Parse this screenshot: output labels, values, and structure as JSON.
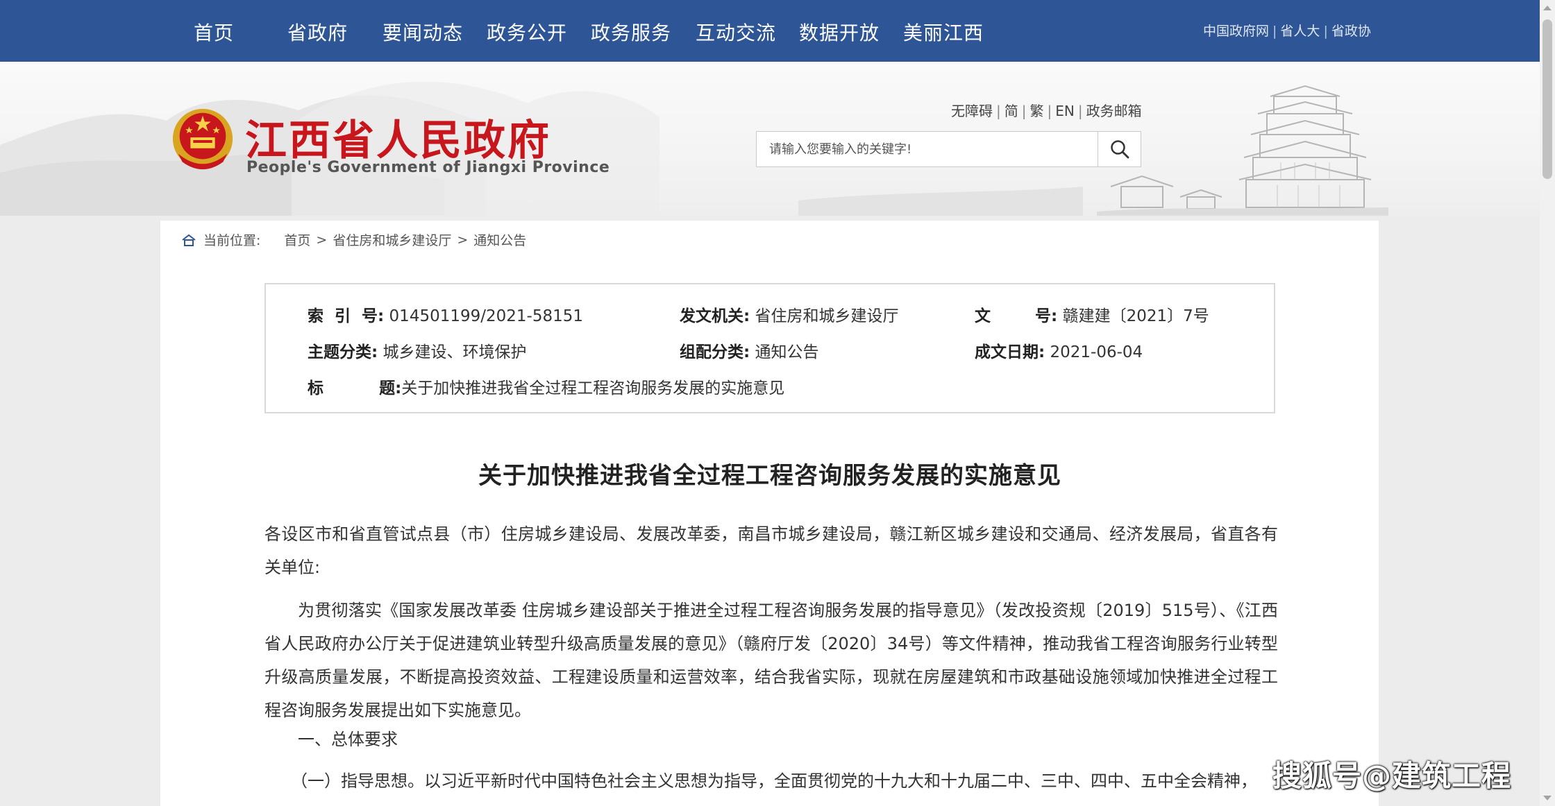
{
  "nav": {
    "items": [
      "首页",
      "省政府",
      "要闻动态",
      "政务公开",
      "政务服务",
      "互动交流",
      "数据开放",
      "美丽江西"
    ],
    "links": [
      "中国政府网",
      "省人大",
      "省政协"
    ]
  },
  "header": {
    "title": "江西省人民政府",
    "subtitle": "People's Government of Jiangxi Province",
    "utilities": [
      "无障碍",
      "简",
      "繁",
      "EN",
      "政务邮箱"
    ],
    "search_placeholder": "请输入您要输入的关键字!"
  },
  "breadcrumb": {
    "label": "当前位置:",
    "items": [
      "首页",
      "省住房和城乡建设厅",
      "通知公告"
    ]
  },
  "doc_info": {
    "index_key": "索  引  号:",
    "index_value": "014501199/2021-58151",
    "issuer_key": "发文机关:",
    "issuer_value": "省住房和城乡建设厅",
    "number_key": "文        号:",
    "number_value": "赣建建〔2021〕7号",
    "subject_key": "主题分类:",
    "subject_value": "城乡建设、环境保护",
    "category_key": "组配分类:",
    "category_value": "通知公告",
    "date_key": "成文日期:",
    "date_value": "2021-06-04",
    "title_key": "标          题:",
    "title_value": "关于加快推进我省全过程工程咨询服务发展的实施意见"
  },
  "article": {
    "title": "关于加快推进我省全过程工程咨询服务发展的实施意见",
    "addressee": "各设区市和省直管试点县（市）住房城乡建设局、发展改革委，南昌市城乡建设局，赣江新区城乡建设和交通局、经济发展局，省直各有关单位:",
    "para1": "为贯彻落实《国家发展改革委 住房城乡建设部关于推进全过程工程咨询服务发展的指导意见》（发改投资规〔2019〕515号）、《江西省人民政府办公厅关于促进建筑业转型升级高质量发展的意见》（赣府厅发〔2020〕34号）等文件精神，推动我省工程咨询服务行业转型升级高质量发展，不断提高投资效益、工程建设质量和运营效率，结合我省实际，现就在房屋建筑和市政基础设施领域加快推进全过程工程咨询服务发展提出如下实施意见。",
    "section1": "一、总体要求",
    "para2": "（一）指导思想。以习近平新时代中国特色社会主义思想为指导，全面贯彻党的十九大和十九届二中、三中、四中、五中全会精神，"
  },
  "watermark": "搜狐号@建筑工程"
}
